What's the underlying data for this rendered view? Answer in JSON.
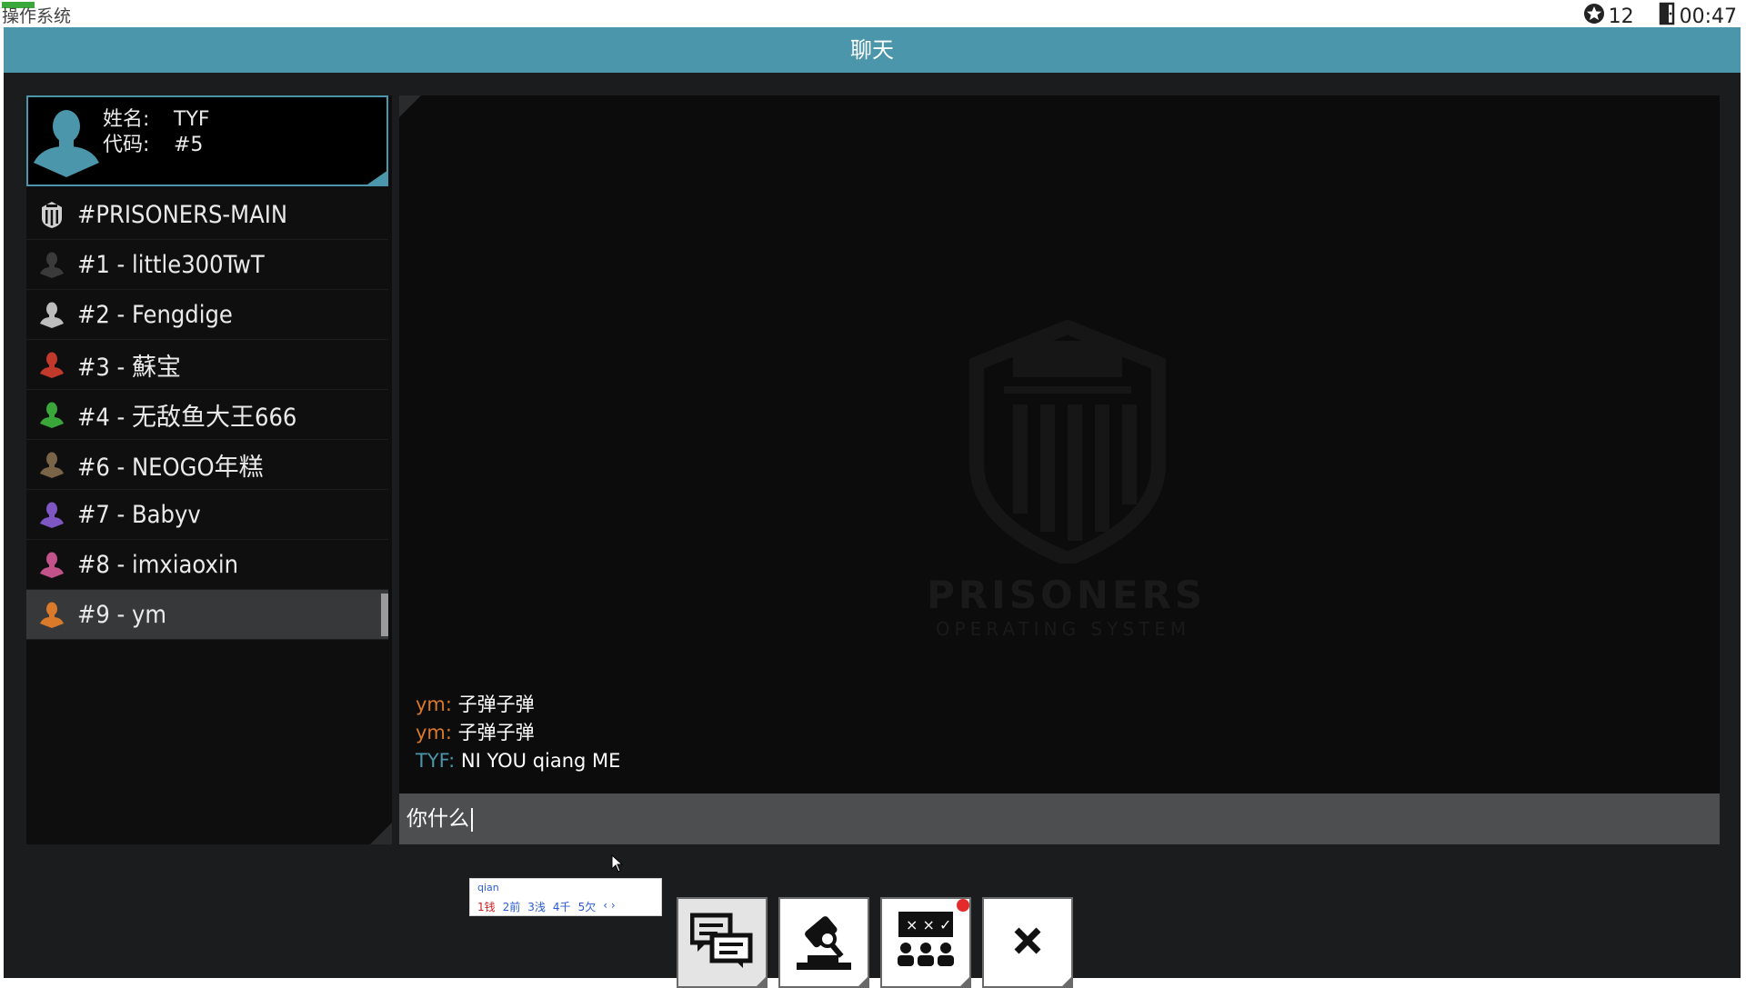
{
  "os": {
    "title": "操作系统",
    "coin_count": "12",
    "time": "00:47",
    "coin_icon": "coin-icon",
    "door_icon": "door-icon"
  },
  "window": {
    "title": "聊天"
  },
  "profile": {
    "name_label": "姓名:",
    "name_value": "TYF",
    "code_label": "代码:",
    "code_value": "#5",
    "avatar_color": "#4b96aa"
  },
  "channels": [
    {
      "label": "#PRISONERS-MAIN",
      "icon": "prison-icon",
      "color": "#cfcfcf"
    },
    {
      "label": "#1 - little300TwT",
      "icon": "user-icon",
      "color": "#3a3a3a"
    },
    {
      "label": "#2 - Fengdige",
      "icon": "user-icon",
      "color": "#bdbdbd"
    },
    {
      "label": "#3 - 蘇宝",
      "icon": "user-icon",
      "color": "#c0392b"
    },
    {
      "label": "#4 - 无敌鱼大王666",
      "icon": "user-icon",
      "color": "#3aa53a"
    },
    {
      "label": "#6 - NEOGO年糕",
      "icon": "user-icon",
      "color": "#7a6448"
    },
    {
      "label": "#7 - Babyv",
      "icon": "user-icon",
      "color": "#7e57c2"
    },
    {
      "label": "#8 - imxiaoxin",
      "icon": "user-icon",
      "color": "#c2528a"
    },
    {
      "label": "#9 - ym",
      "icon": "user-icon",
      "color": "#d9792a",
      "selected": true
    }
  ],
  "watermark": {
    "title": "PRISONERS",
    "subtitle": "OPERATING SYSTEM"
  },
  "messages": [
    {
      "sender": "ym:",
      "text": " 子弹子弹",
      "sender_color": "#d9792a"
    },
    {
      "sender": "ym:",
      "text": " 子弹子弹",
      "sender_color": "#d9792a"
    },
    {
      "sender": "TYF:",
      "text": " NI YOU qiang ME",
      "sender_color": "#4b96aa"
    }
  ],
  "input": {
    "value": "你什么"
  },
  "ime": {
    "pinyin": "qian",
    "candidates": [
      "1钱",
      "2前",
      "3浅",
      "4千",
      "5欠",
      "‹ ›"
    ]
  },
  "buttons": [
    {
      "name": "chat-button",
      "icon": "chat-bubbles-icon",
      "active": true
    },
    {
      "name": "judge-button",
      "icon": "gavel-icon"
    },
    {
      "name": "vote-button",
      "icon": "vote-board-icon",
      "notification": true
    },
    {
      "name": "close-button",
      "icon": "close-icon"
    }
  ]
}
